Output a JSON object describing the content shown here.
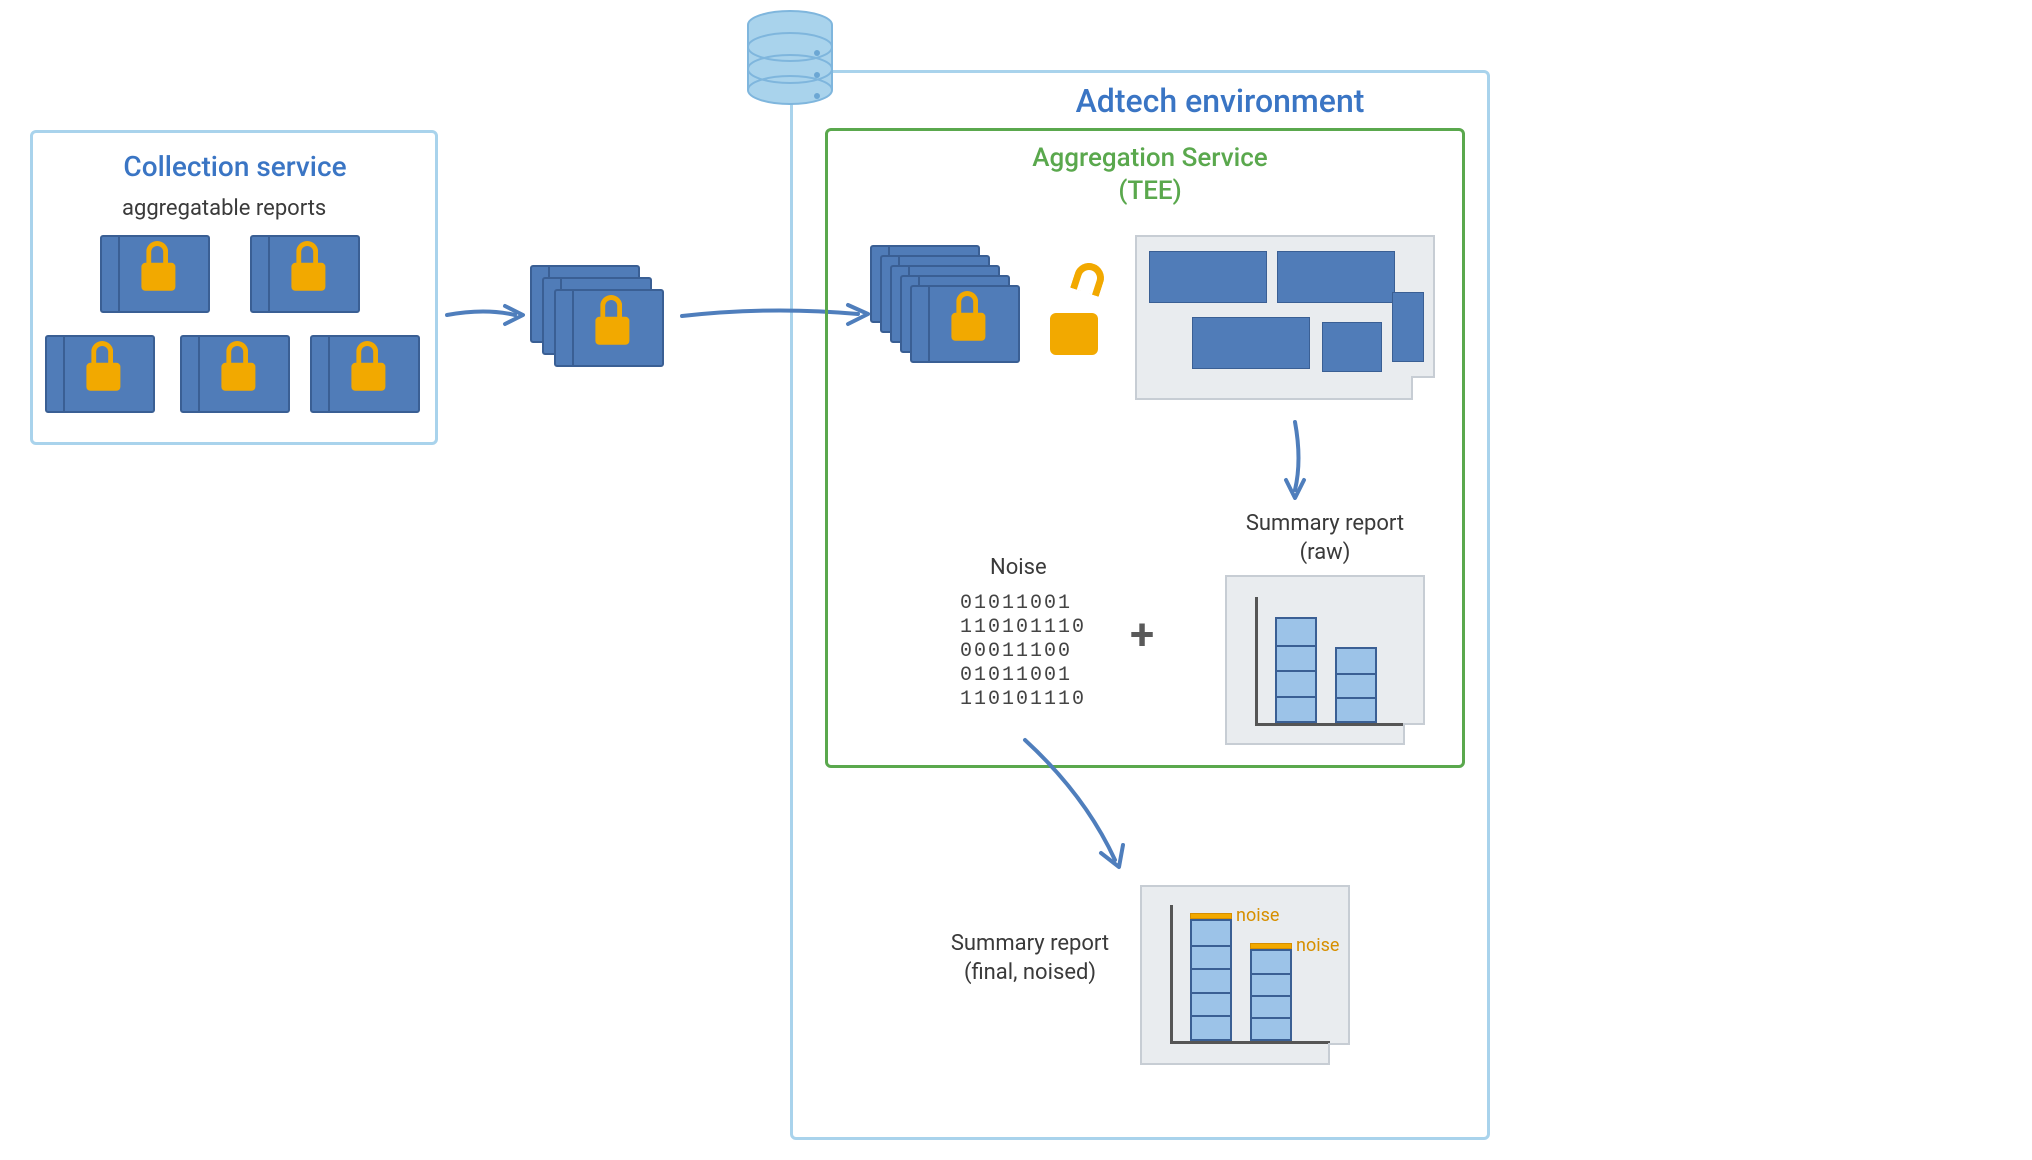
{
  "collection_service": {
    "title": "Collection service",
    "reports_label": "aggregatable reports"
  },
  "adtech_env": {
    "title": "Adtech environment",
    "aggregation_service": {
      "title_line1": "Aggregation Service",
      "title_line2": "(TEE)",
      "noise_label": "Noise",
      "noise_bits": "01011001\n110101110\n00011100\n01011001\n110101110",
      "plus": "+",
      "summary_raw_line1": "Summary report",
      "summary_raw_line2": "(raw)"
    },
    "output": {
      "summary_final_line1": "Summary report",
      "summary_final_line2": "(final, noised)",
      "noise_bar_label": "noise"
    }
  },
  "icons": {
    "database": "database-icon",
    "lock": "lock-icon",
    "unlock": "unlock-icon",
    "arrow": "arrow-icon"
  },
  "colors": {
    "light_blue": "#a9d3ec",
    "mid_blue": "#507cb8",
    "title_blue": "#3a75c4",
    "green": "#5aa84d",
    "orange": "#f2a900",
    "sheet_gray": "#e9ecef"
  }
}
